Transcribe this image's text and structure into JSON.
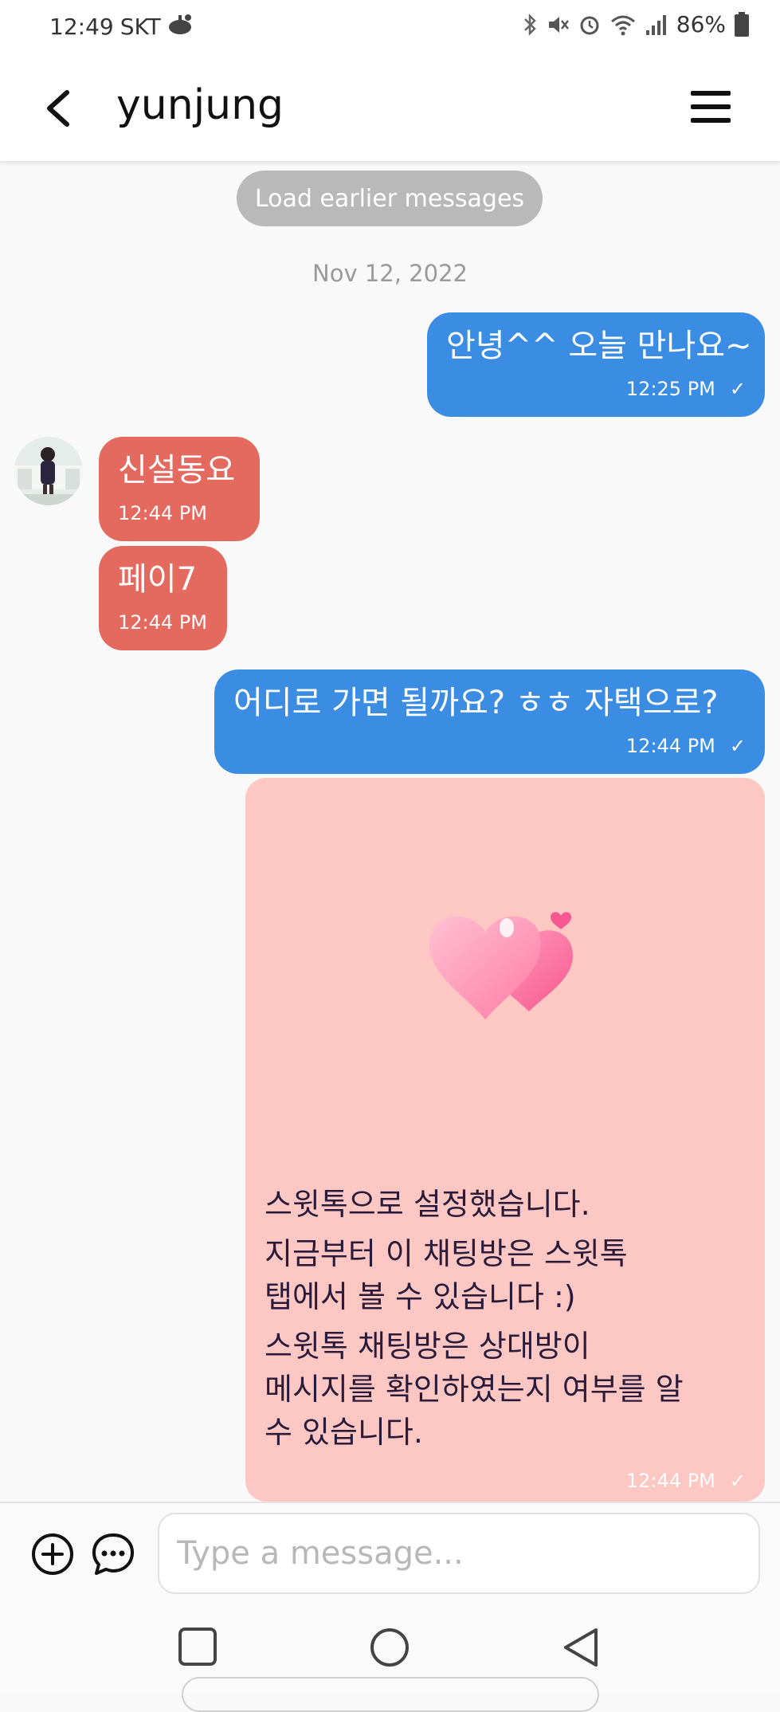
{
  "status_bar": {
    "time": "12:49",
    "carrier": "SKT",
    "battery": "86%"
  },
  "header": {
    "title": "yunjung",
    "back_icon": "chevron-left-icon",
    "menu_icon": "hamburger-menu-icon"
  },
  "load_earlier": "Load earlier messages",
  "date_separator": "Nov 12, 2022",
  "messages": [
    {
      "direction": "out",
      "text": "안녕^^ 오늘 만나요~",
      "time": "12:25 PM",
      "status": "✓"
    },
    {
      "direction": "in",
      "text": "신설동요",
      "time": "12:44 PM"
    },
    {
      "direction": "in",
      "text": "페이7",
      "time": "12:44 PM"
    },
    {
      "direction": "out",
      "text": "어디로 가면 될까요? ㅎㅎ 자택으로?",
      "time": "12:44 PM",
      "status": "✓"
    }
  ],
  "card": {
    "icon": "two-hearts-icon",
    "lines": [
      "스윗톡으로 설정했습니다.",
      "지금부터 이 채팅방은 스윗톡",
      "탭에서 볼 수 있습니다 :)",
      "스윗톡 채팅방은 상대방이",
      "메시지를 확인하였는지 여부를 알",
      "수 있습니다."
    ],
    "time": "12:44 PM",
    "status": "✓"
  },
  "composer": {
    "placeholder": "Type a message...",
    "value": ""
  },
  "colors": {
    "outgoing": "#3b8de3",
    "incoming": "#e46a5f",
    "card": "#fdc7c3",
    "load_button": "#b9b9b9"
  }
}
